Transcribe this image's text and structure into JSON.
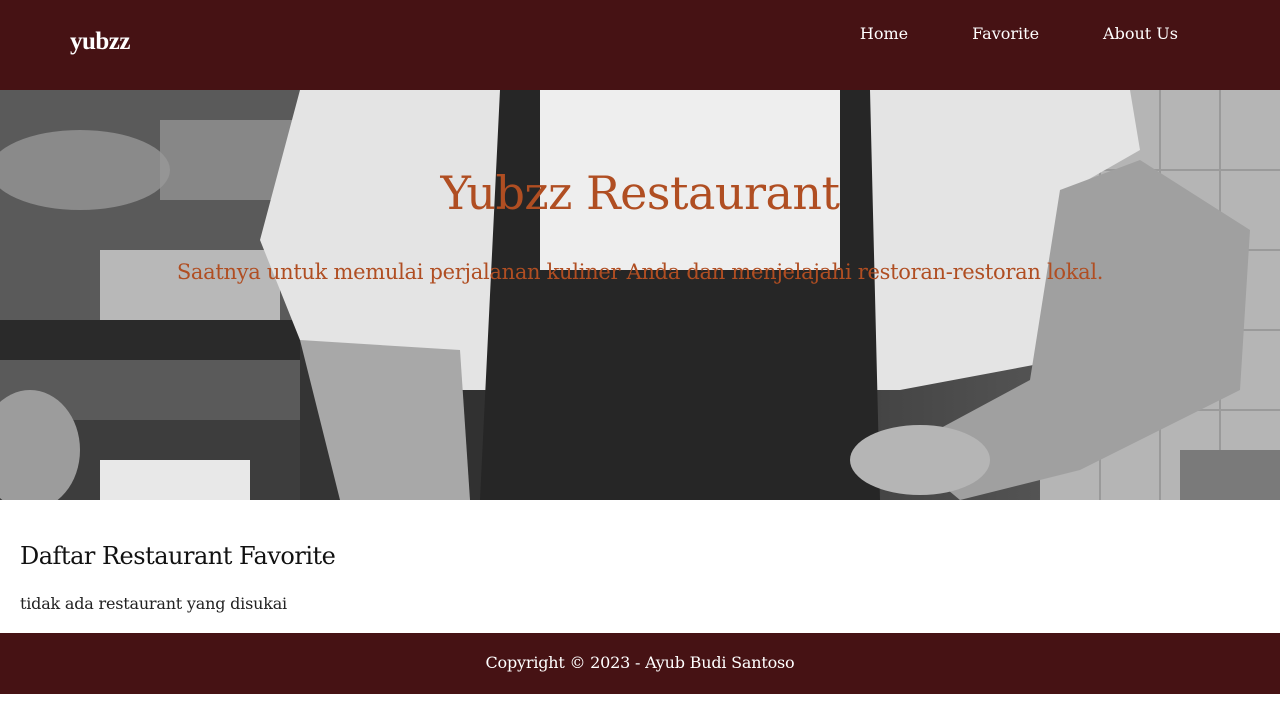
{
  "header": {
    "brand": "yubzz",
    "nav": [
      {
        "label": "Home"
      },
      {
        "label": "Favorite"
      },
      {
        "label": "About Us"
      }
    ]
  },
  "hero": {
    "title": "Yubzz Restaurant",
    "tagline": "Saatnya untuk memulai perjalanan kuliner Anda dan menjelajahi restoran-restoran lokal.",
    "image": "chef-kitchen-photo-grayscale"
  },
  "main": {
    "section_title": "Daftar Restaurant Favorite",
    "empty_message": "tidak ada restaurant yang disukai"
  },
  "footer": {
    "copyright": "Copyright © 2023 - Ayub Budi Santoso"
  },
  "colors": {
    "bar": "#461214",
    "accent_text": "#b04e22",
    "white": "#ffffff"
  }
}
